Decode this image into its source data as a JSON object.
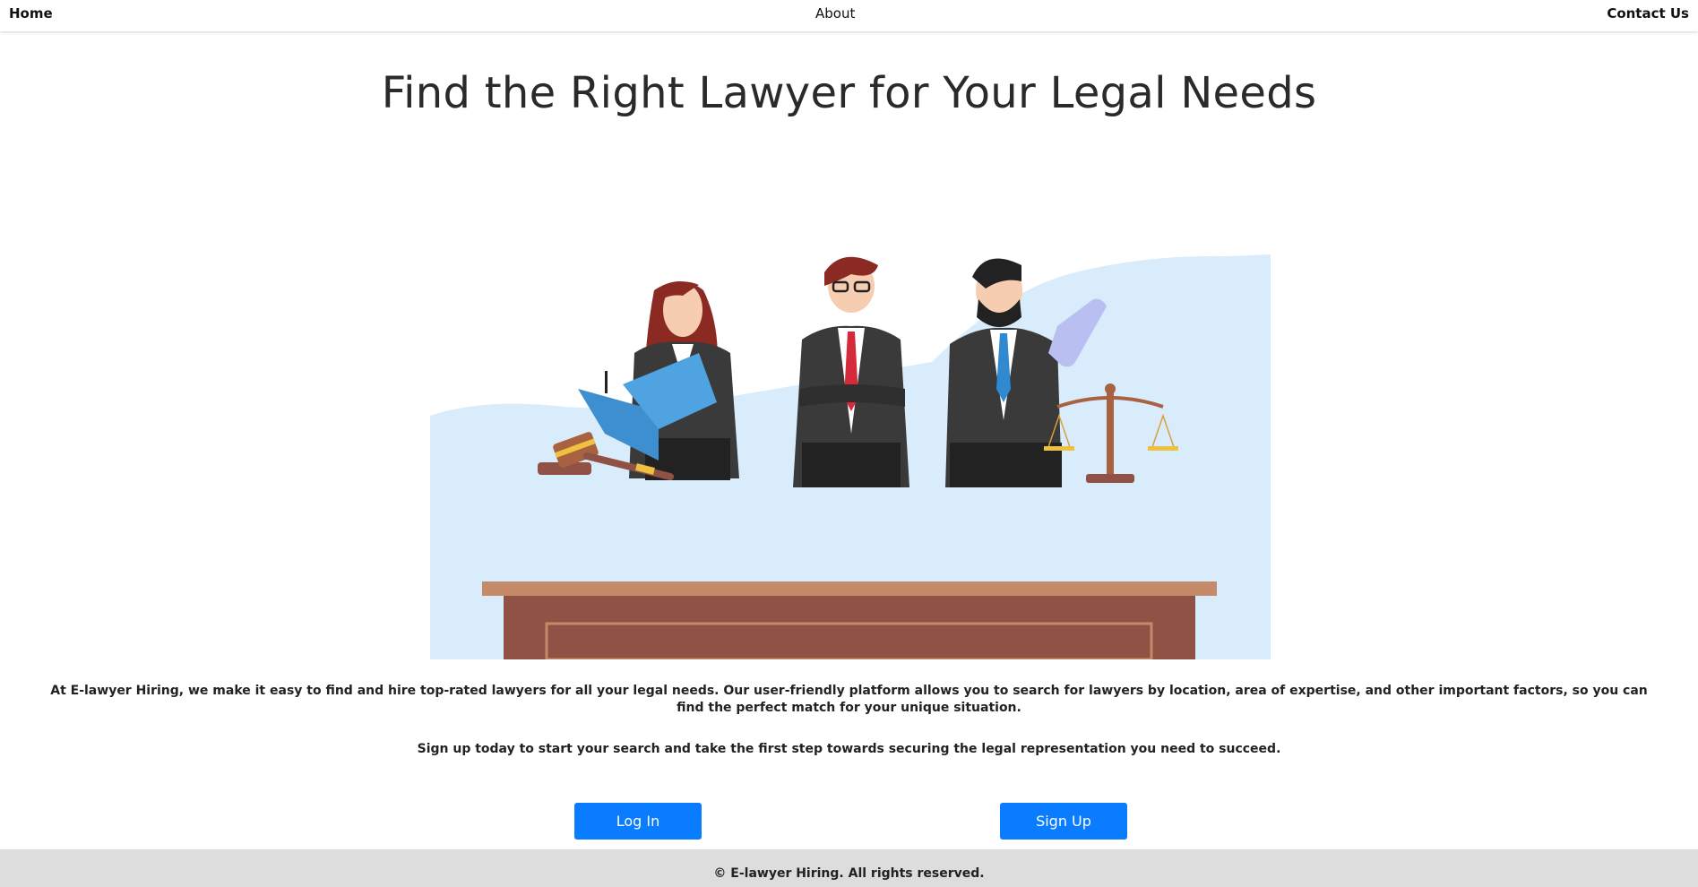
{
  "nav": {
    "home_label": "Home",
    "about_label": "About",
    "contact_label": "Contact Us"
  },
  "page": {
    "title": "Find the Right Lawyer for Your Legal Needs"
  },
  "content": {
    "intro": "At E-lawyer Hiring, we make it easy to find and hire top-rated lawyers for all your legal needs. Our user-friendly platform allows you to search for lawyers by location, area of expertise, and other important factors, so you can find the perfect match for your unique situation.",
    "cta": "Sign up today to start your search and take the first step towards securing the legal representation you need to succeed."
  },
  "buttons": {
    "login_label": "Log In",
    "signup_label": "Sign Up"
  },
  "footer": {
    "text": "© E-lawyer Hiring. All rights reserved."
  },
  "colors": {
    "button": "#0a7cff",
    "footer_bg": "#dddddd",
    "hero_bg": "#d9ecfb",
    "desk": "#8f5245"
  }
}
